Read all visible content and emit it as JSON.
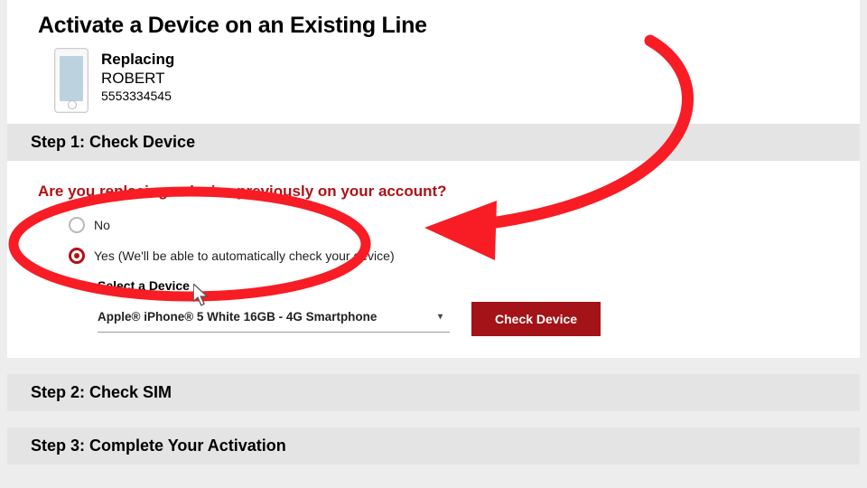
{
  "page_title": "Activate a Device on an Existing Line",
  "current_device": {
    "label": "Replacing",
    "name": "ROBERT",
    "phone": "5553334545"
  },
  "step1": {
    "title": "Step 1: Check Device",
    "question": "Are you replacing a device previously on your account?",
    "option_no": "No",
    "option_yes": "Yes (We'll be able to automatically check your device)",
    "selected": "yes",
    "select_label": "Select a Device",
    "selected_device": "Apple® iPhone® 5 White 16GB - 4G Smartphone",
    "button": "Check Device"
  },
  "step2": {
    "title": "Step 2: Check SIM"
  },
  "step3": {
    "title": "Step 3: Complete Your Activation"
  },
  "annotation": {
    "circle_color": "#f81c24",
    "arrow_color": "#f81c24"
  }
}
